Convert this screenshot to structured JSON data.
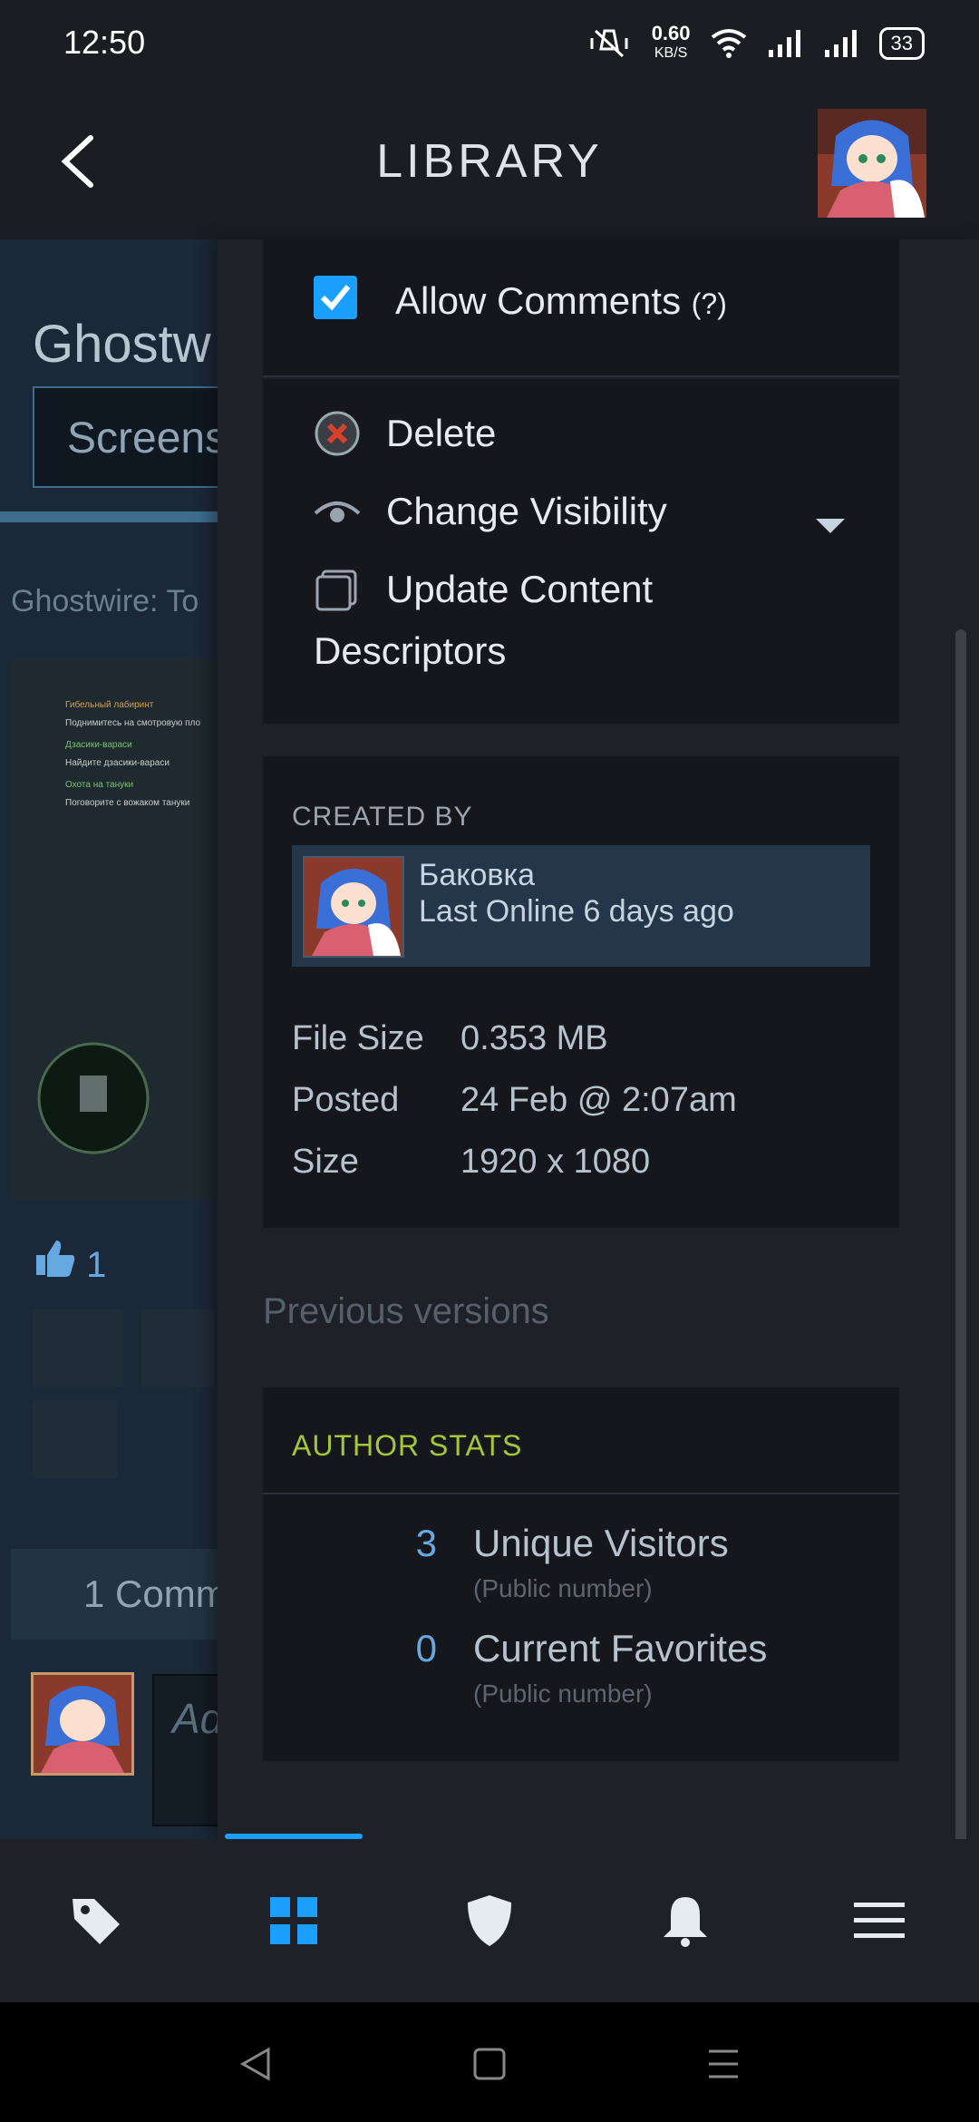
{
  "status_bar": {
    "time": "12:50",
    "net_speed": "0.60",
    "net_unit": "KB/S",
    "battery": "33"
  },
  "app_bar": {
    "title": "LIBRARY"
  },
  "background_page": {
    "title": "Ghostw",
    "tab": "Screens",
    "subtitle": "Ghostwire: To",
    "rating_count": "1",
    "comments": "1 Comm",
    "comment_placeholder": "Ad",
    "screenshot_lines": [
      "Гибельный лабиринт",
      "Поднимитесь на смотровую пло",
      "Дзасики-вараси",
      "Найдите дзасики-вараси",
      "Охота на тануки",
      "Поговорите с вожаком тануки"
    ]
  },
  "drawer": {
    "allow_comments": {
      "label": "Allow Comments",
      "help": "(?)",
      "checked": true
    },
    "actions": {
      "delete": "Delete",
      "change_visibility": "Change Visibility",
      "update_content": "Update Content",
      "descriptors": "Descriptors"
    },
    "created_by": {
      "label": "CREATED BY",
      "user_name": "Баковка",
      "last_online": "Last Online 6 days ago"
    },
    "details": [
      {
        "key": "File Size",
        "value": "0.353 MB"
      },
      {
        "key": "Posted",
        "value": "24 Feb @ 2:07am"
      },
      {
        "key": "Size",
        "value": "1920 x 1080"
      }
    ],
    "previous_versions": "Previous versions",
    "author_stats": {
      "label": "AUTHOR STATS",
      "items": [
        {
          "value": "3",
          "label": "Unique Visitors",
          "note": "(Public number)"
        },
        {
          "value": "0",
          "label": "Current Favorites",
          "note": "(Public number)"
        }
      ]
    }
  },
  "bottom_nav": {
    "items": [
      "tag-icon",
      "grid-icon",
      "shield-icon",
      "bell-icon",
      "menu-icon"
    ],
    "active": "grid-icon"
  },
  "colors": {
    "accent": "#1a9fff",
    "stats_label": "#a4c639",
    "stat_value": "#66a9e0"
  }
}
